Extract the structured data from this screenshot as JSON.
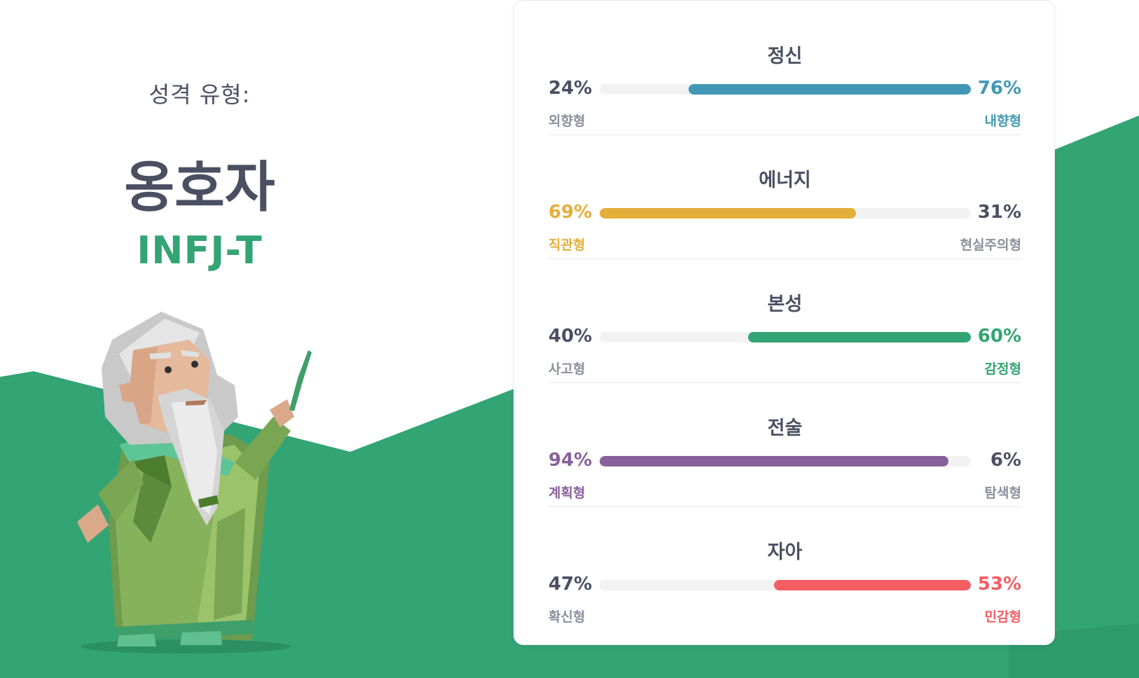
{
  "colors": {
    "green": "#33a474",
    "text": "#4a5062",
    "muted": "#8c909b",
    "blue": "#4298b4",
    "yellow": "#e4ae3a",
    "purple": "#88619a",
    "red": "#f25e62"
  },
  "profile": {
    "type_label": "성격 유형:",
    "type_name": "옹호자",
    "type_code": "INFJ-T",
    "illustration": "advocate-sage-character"
  },
  "traits": [
    {
      "title": "정신",
      "left_percent": "24%",
      "right_percent": "76%",
      "left_label": "외향형",
      "right_label": "내향형",
      "dominant": "right",
      "fill_ratio": 0.76,
      "color": "#4298b4"
    },
    {
      "title": "에너지",
      "left_percent": "69%",
      "right_percent": "31%",
      "left_label": "직관형",
      "right_label": "현실주의형",
      "dominant": "left",
      "fill_ratio": 0.69,
      "color": "#e4ae3a"
    },
    {
      "title": "본성",
      "left_percent": "40%",
      "right_percent": "60%",
      "left_label": "사고형",
      "right_label": "감정형",
      "dominant": "right",
      "fill_ratio": 0.6,
      "color": "#33a474"
    },
    {
      "title": "전술",
      "left_percent": "94%",
      "right_percent": "6%",
      "left_label": "계획형",
      "right_label": "탐색형",
      "dominant": "left",
      "fill_ratio": 0.94,
      "color": "#88619a"
    },
    {
      "title": "자아",
      "left_percent": "47%",
      "right_percent": "53%",
      "left_label": "확신형",
      "right_label": "민감형",
      "dominant": "right",
      "fill_ratio": 0.53,
      "color": "#f25e62"
    }
  ]
}
